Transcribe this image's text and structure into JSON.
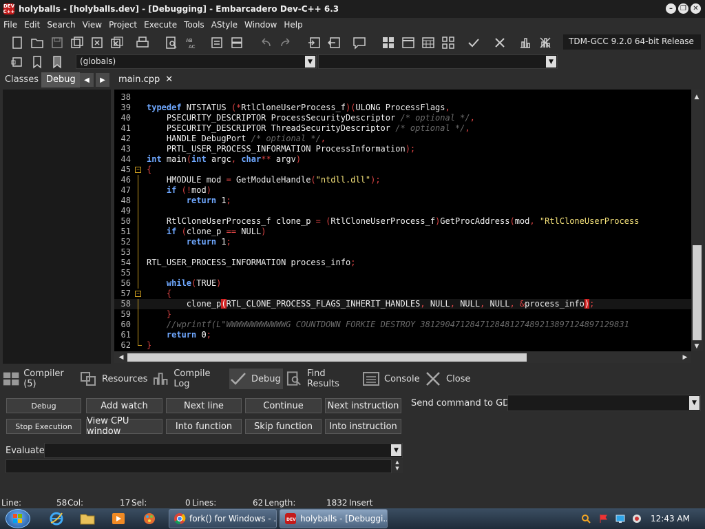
{
  "window": {
    "title": "holyballs - [holyballs.dev] - [Debugging] - Embarcadero Dev-C++ 6.3",
    "app_icon_text": "DEV C++"
  },
  "menu": [
    "File",
    "Edit",
    "Search",
    "View",
    "Project",
    "Execute",
    "Tools",
    "AStyle",
    "Window",
    "Help"
  ],
  "toolbar": {
    "compiler": "TDM-GCC 9.2.0 64-bit Release",
    "scope_combo": "(globals)"
  },
  "left_panel": {
    "tabs": [
      "Classes",
      "Debug"
    ],
    "active_tab": "Debug"
  },
  "editor": {
    "tab": "main.cpp",
    "lines": [
      {
        "n": "38",
        "html": ""
      },
      {
        "n": "39",
        "html": "<span class=\"kw\">typedef</span> NTSTATUS <span class=\"op\">(*</span>RtlCloneUserProcess_f<span class=\"op\">)(</span>ULONG ProcessFlags<span class=\"op\">,</span>"
      },
      {
        "n": "40",
        "html": "    PSECURITY_DESCRIPTOR ProcessSecurityDescriptor <span class=\"cmt\">/* optional */</span><span class=\"op\">,</span>"
      },
      {
        "n": "41",
        "html": "    PSECURITY_DESCRIPTOR ThreadSecurityDescriptor <span class=\"cmt\">/* optional */</span><span class=\"op\">,</span>"
      },
      {
        "n": "42",
        "html": "    HANDLE DebugPort <span class=\"cmt\">/* optional */</span><span class=\"op\">,</span>"
      },
      {
        "n": "43",
        "html": "    PRTL_USER_PROCESS_INFORMATION ProcessInformation<span class=\"op\">);</span>"
      },
      {
        "n": "44",
        "html": "<span class=\"kw\">int</span> main<span class=\"op\">(</span><span class=\"kw\">int</span> argc<span class=\"op\">,</span> <span class=\"kw\">char</span><span class=\"op\">**</span> argv<span class=\"op\">)</span>"
      },
      {
        "n": "45",
        "fold": "open",
        "html": "<span class=\"op\">{</span>"
      },
      {
        "n": "46",
        "guide": true,
        "html": "    HMODULE mod <span class=\"op\">=</span> GetModuleHandle<span class=\"op\">(</span><span class=\"str\">\"ntdll.dll\"</span><span class=\"op\">);</span>"
      },
      {
        "n": "47",
        "guide": true,
        "html": "    <span class=\"kw\">if</span> <span class=\"op\">(!</span>mod<span class=\"op\">)</span>"
      },
      {
        "n": "48",
        "guide": true,
        "html": "        <span class=\"kw\">return</span> <span class=\"num\">1</span><span class=\"op\">;</span>"
      },
      {
        "n": "49",
        "guide": true,
        "html": ""
      },
      {
        "n": "50",
        "guide": true,
        "html": "    RtlCloneUserProcess_f clone_p <span class=\"op\">=</span> <span class=\"op\">(</span>RtlCloneUserProcess_f<span class=\"op\">)</span>GetProcAddress<span class=\"op\">(</span>mod<span class=\"op\">,</span> <span class=\"str\">\"RtlCloneUserProcess</span>"
      },
      {
        "n": "51",
        "guide": true,
        "html": "    <span class=\"kw\">if</span> <span class=\"op\">(</span>clone_p <span class=\"op\">==</span> NULL<span class=\"op\">)</span>"
      },
      {
        "n": "52",
        "guide": true,
        "html": "        <span class=\"kw\">return</span> <span class=\"num\">1</span><span class=\"op\">;</span>"
      },
      {
        "n": "53",
        "guide": true,
        "html": ""
      },
      {
        "n": "54",
        "guide": true,
        "html": "RTL_USER_PROCESS_INFORMATION process_info<span class=\"op\">;</span>"
      },
      {
        "n": "55",
        "guide": true,
        "html": ""
      },
      {
        "n": "56",
        "guide": true,
        "html": "    <span class=\"kw\">while</span><span class=\"op\">(</span>TRUE<span class=\"op\">)</span>"
      },
      {
        "n": "57",
        "fold": "open",
        "html": "    <span class=\"op\">{</span>"
      },
      {
        "n": "58",
        "guide": true,
        "hl": true,
        "html": "        clone_p<span class=\"cur\">(</span>RTL_CLONE_PROCESS_FLAGS_INHERIT_HANDLES<span class=\"op\">,</span> NULL<span class=\"op\">,</span> NULL<span class=\"op\">,</span> NULL<span class=\"op\">,</span> <span class=\"op\">&amp;</span>process_info<span class=\"cur\">)</span><span class=\"op\">;</span>"
      },
      {
        "n": "59",
        "guide": true,
        "html": "    <span class=\"op\">}</span>"
      },
      {
        "n": "60",
        "guide": true,
        "html": "    <span class=\"cmt\">//wprintf(L\"WWWWWWWWWWWWG COUNTDOWN FORKIE DESTROY 381290471284712848127489213897124897129831</span>"
      },
      {
        "n": "61",
        "guide": true,
        "html": "    <span class=\"kw\">return</span> <span class=\"num\">0</span><span class=\"op\">;</span>"
      },
      {
        "n": "62",
        "fold": "end",
        "html": "<span class=\"op\">}</span>"
      }
    ]
  },
  "bottom_tabs": [
    {
      "label": "Compiler (5)",
      "icon": "grid-icon"
    },
    {
      "label": "Resources",
      "icon": "resources-icon"
    },
    {
      "label": "Compile Log",
      "icon": "chart-icon"
    },
    {
      "label": "Debug",
      "icon": "check-icon",
      "active": true
    },
    {
      "label": "Find Results",
      "icon": "find-icon"
    },
    {
      "label": "Console",
      "icon": "console-icon"
    },
    {
      "label": "Close",
      "icon": "close-icon"
    }
  ],
  "debug": {
    "buttons_row1": [
      "Debug",
      "Add watch",
      "Next line",
      "Continue",
      "Next instruction"
    ],
    "buttons_row2": [
      "Stop Execution",
      "View CPU window",
      "Into function",
      "Skip function",
      "Into instruction"
    ],
    "gdb_label": "Send command to GDB:",
    "evaluate_label": "Evaluate:"
  },
  "status": {
    "line_label": "Line:",
    "line_value": "58",
    "col_label": "Col:",
    "col_value": "17",
    "sel_label": "Sel:",
    "sel_value": "0",
    "lines_label": "Lines:",
    "lines_value": "62",
    "length_label": "Length:",
    "length_value": "1832",
    "mode": "Insert"
  },
  "taskbar": {
    "tasks": [
      {
        "label": "fork() for Windows - ...",
        "active": false
      },
      {
        "label": "holyballs - [Debuggi...",
        "active": true
      }
    ],
    "clock": "12:43 AM"
  }
}
